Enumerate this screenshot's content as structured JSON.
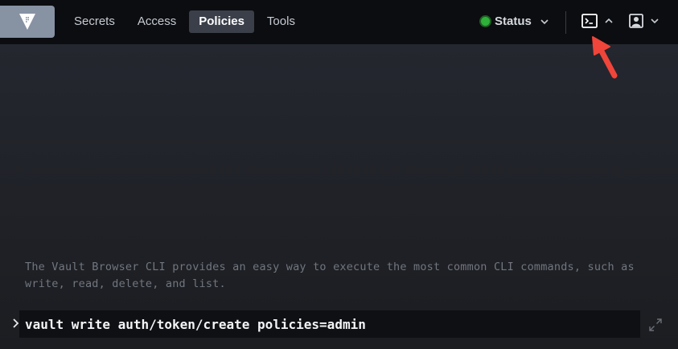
{
  "header": {
    "nav": [
      {
        "label": "Secrets",
        "active": false
      },
      {
        "label": "Access",
        "active": false
      },
      {
        "label": "Policies",
        "active": true
      },
      {
        "label": "Tools",
        "active": false
      }
    ],
    "status_label": "Status",
    "status_color": "#2eb039",
    "icons": {
      "logo": "vault-logo-icon",
      "console": "terminal-icon",
      "console_caret": "chevron-up-icon",
      "user": "user-icon",
      "user_caret": "chevron-down-icon",
      "status_caret": "chevron-down-icon"
    }
  },
  "cli": {
    "help_text": "The Vault Browser CLI provides an easy way to execute the most common CLI commands, such as write, read, delete, and list.",
    "command_value": "vault write auth/token/create policies=admin",
    "prompt_icon": "chevron-right-icon",
    "expand_icon": "expand-icon"
  },
  "annotation": {
    "type": "arrow",
    "color": "#f0453a"
  }
}
